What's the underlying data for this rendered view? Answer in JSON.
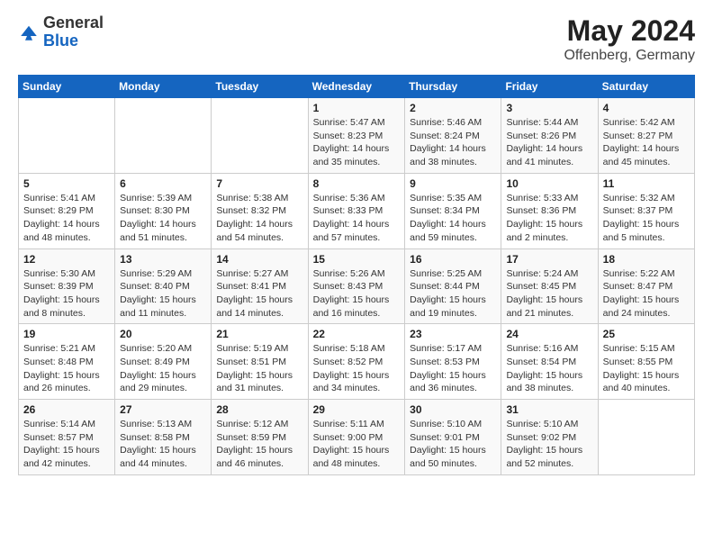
{
  "header": {
    "logo_general": "General",
    "logo_blue": "Blue",
    "title": "May 2024",
    "location": "Offenberg, Germany"
  },
  "weekdays": [
    "Sunday",
    "Monday",
    "Tuesday",
    "Wednesday",
    "Thursday",
    "Friday",
    "Saturday"
  ],
  "weeks": [
    [
      {
        "day": "",
        "info": ""
      },
      {
        "day": "",
        "info": ""
      },
      {
        "day": "",
        "info": ""
      },
      {
        "day": "1",
        "info": "Sunrise: 5:47 AM\nSunset: 8:23 PM\nDaylight: 14 hours\nand 35 minutes."
      },
      {
        "day": "2",
        "info": "Sunrise: 5:46 AM\nSunset: 8:24 PM\nDaylight: 14 hours\nand 38 minutes."
      },
      {
        "day": "3",
        "info": "Sunrise: 5:44 AM\nSunset: 8:26 PM\nDaylight: 14 hours\nand 41 minutes."
      },
      {
        "day": "4",
        "info": "Sunrise: 5:42 AM\nSunset: 8:27 PM\nDaylight: 14 hours\nand 45 minutes."
      }
    ],
    [
      {
        "day": "5",
        "info": "Sunrise: 5:41 AM\nSunset: 8:29 PM\nDaylight: 14 hours\nand 48 minutes."
      },
      {
        "day": "6",
        "info": "Sunrise: 5:39 AM\nSunset: 8:30 PM\nDaylight: 14 hours\nand 51 minutes."
      },
      {
        "day": "7",
        "info": "Sunrise: 5:38 AM\nSunset: 8:32 PM\nDaylight: 14 hours\nand 54 minutes."
      },
      {
        "day": "8",
        "info": "Sunrise: 5:36 AM\nSunset: 8:33 PM\nDaylight: 14 hours\nand 57 minutes."
      },
      {
        "day": "9",
        "info": "Sunrise: 5:35 AM\nSunset: 8:34 PM\nDaylight: 14 hours\nand 59 minutes."
      },
      {
        "day": "10",
        "info": "Sunrise: 5:33 AM\nSunset: 8:36 PM\nDaylight: 15 hours\nand 2 minutes."
      },
      {
        "day": "11",
        "info": "Sunrise: 5:32 AM\nSunset: 8:37 PM\nDaylight: 15 hours\nand 5 minutes."
      }
    ],
    [
      {
        "day": "12",
        "info": "Sunrise: 5:30 AM\nSunset: 8:39 PM\nDaylight: 15 hours\nand 8 minutes."
      },
      {
        "day": "13",
        "info": "Sunrise: 5:29 AM\nSunset: 8:40 PM\nDaylight: 15 hours\nand 11 minutes."
      },
      {
        "day": "14",
        "info": "Sunrise: 5:27 AM\nSunset: 8:41 PM\nDaylight: 15 hours\nand 14 minutes."
      },
      {
        "day": "15",
        "info": "Sunrise: 5:26 AM\nSunset: 8:43 PM\nDaylight: 15 hours\nand 16 minutes."
      },
      {
        "day": "16",
        "info": "Sunrise: 5:25 AM\nSunset: 8:44 PM\nDaylight: 15 hours\nand 19 minutes."
      },
      {
        "day": "17",
        "info": "Sunrise: 5:24 AM\nSunset: 8:45 PM\nDaylight: 15 hours\nand 21 minutes."
      },
      {
        "day": "18",
        "info": "Sunrise: 5:22 AM\nSunset: 8:47 PM\nDaylight: 15 hours\nand 24 minutes."
      }
    ],
    [
      {
        "day": "19",
        "info": "Sunrise: 5:21 AM\nSunset: 8:48 PM\nDaylight: 15 hours\nand 26 minutes."
      },
      {
        "day": "20",
        "info": "Sunrise: 5:20 AM\nSunset: 8:49 PM\nDaylight: 15 hours\nand 29 minutes."
      },
      {
        "day": "21",
        "info": "Sunrise: 5:19 AM\nSunset: 8:51 PM\nDaylight: 15 hours\nand 31 minutes."
      },
      {
        "day": "22",
        "info": "Sunrise: 5:18 AM\nSunset: 8:52 PM\nDaylight: 15 hours\nand 34 minutes."
      },
      {
        "day": "23",
        "info": "Sunrise: 5:17 AM\nSunset: 8:53 PM\nDaylight: 15 hours\nand 36 minutes."
      },
      {
        "day": "24",
        "info": "Sunrise: 5:16 AM\nSunset: 8:54 PM\nDaylight: 15 hours\nand 38 minutes."
      },
      {
        "day": "25",
        "info": "Sunrise: 5:15 AM\nSunset: 8:55 PM\nDaylight: 15 hours\nand 40 minutes."
      }
    ],
    [
      {
        "day": "26",
        "info": "Sunrise: 5:14 AM\nSunset: 8:57 PM\nDaylight: 15 hours\nand 42 minutes."
      },
      {
        "day": "27",
        "info": "Sunrise: 5:13 AM\nSunset: 8:58 PM\nDaylight: 15 hours\nand 44 minutes."
      },
      {
        "day": "28",
        "info": "Sunrise: 5:12 AM\nSunset: 8:59 PM\nDaylight: 15 hours\nand 46 minutes."
      },
      {
        "day": "29",
        "info": "Sunrise: 5:11 AM\nSunset: 9:00 PM\nDaylight: 15 hours\nand 48 minutes."
      },
      {
        "day": "30",
        "info": "Sunrise: 5:10 AM\nSunset: 9:01 PM\nDaylight: 15 hours\nand 50 minutes."
      },
      {
        "day": "31",
        "info": "Sunrise: 5:10 AM\nSunset: 9:02 PM\nDaylight: 15 hours\nand 52 minutes."
      },
      {
        "day": "",
        "info": ""
      }
    ]
  ]
}
